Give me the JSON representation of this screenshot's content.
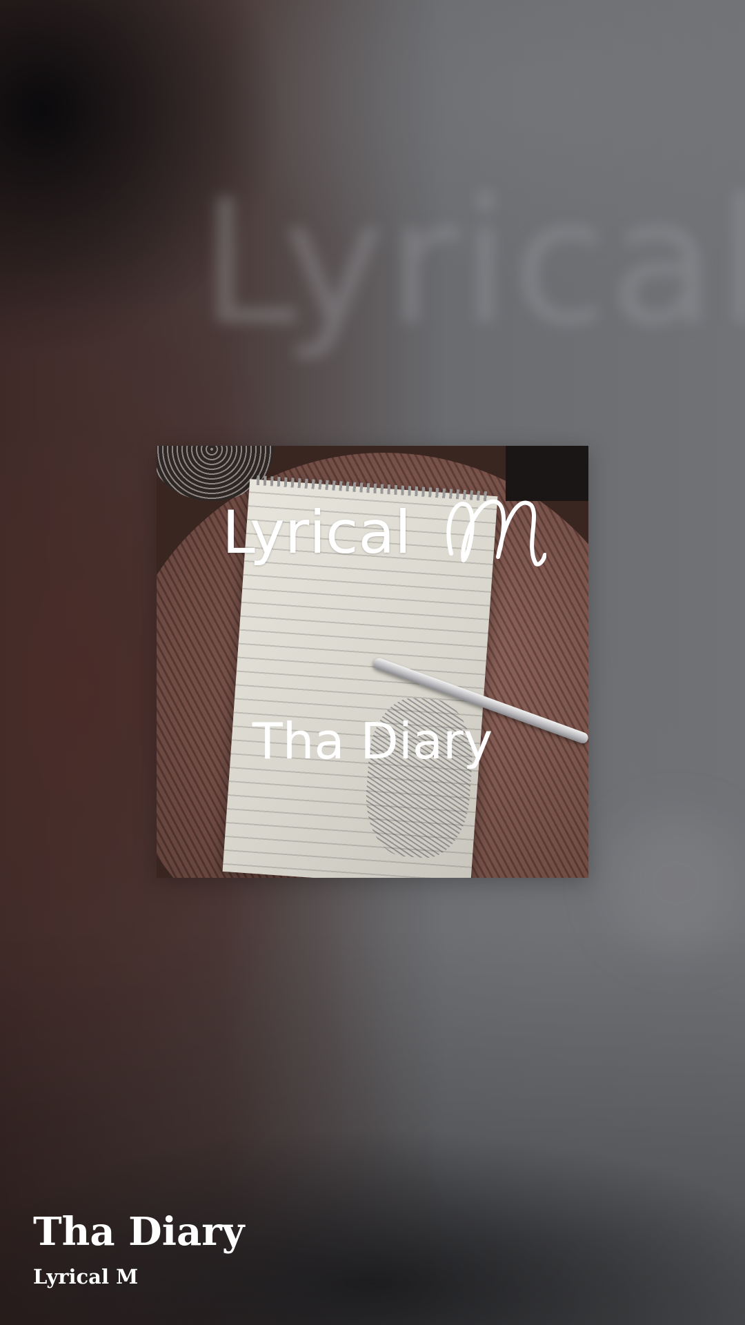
{
  "artwork": {
    "title_text": "Lyrical",
    "subtitle_text": "Tha Diary"
  },
  "track": {
    "title": "Tha Diary",
    "artist": "Lyrical M"
  },
  "colors": {
    "text": "#ffffff",
    "background": "#4a4a4c"
  }
}
